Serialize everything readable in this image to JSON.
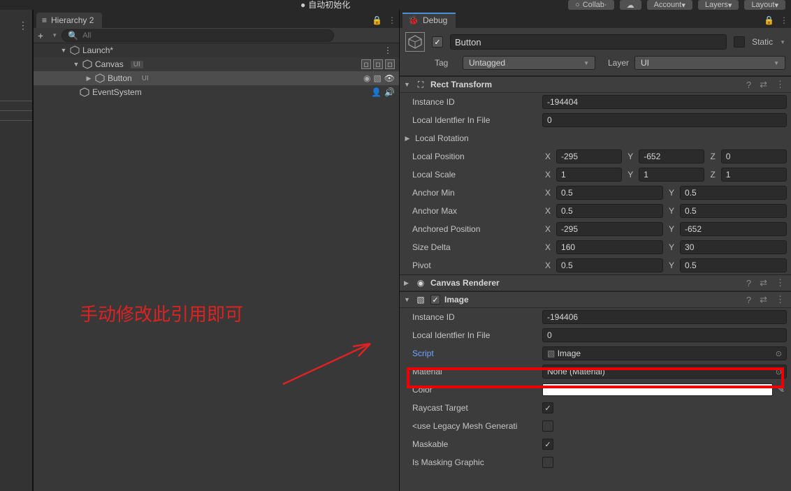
{
  "topbar": {
    "autoinit": "自动初始化",
    "collab": "Collab",
    "account": "Account",
    "layers": "Layers",
    "layout": "Layout"
  },
  "hierarchy": {
    "tab": "Hierarchy 2",
    "search_placeholder": "All",
    "scene": "Launch*",
    "canvas": "Canvas",
    "canvas_tag": "UI",
    "button": "Button",
    "button_tag": "UI",
    "eventsystem": "EventSystem"
  },
  "annotation": "手动修改此引用即可",
  "inspector": {
    "tab": "Debug",
    "name": "Button",
    "static_label": "Static",
    "tag_label": "Tag",
    "tag_value": "Untagged",
    "layer_label": "Layer",
    "layer_value": "UI"
  },
  "rect": {
    "title": "Rect Transform",
    "instance_id_label": "Instance ID",
    "instance_id": "-194404",
    "local_ident_label": "Local Identfier In File",
    "local_ident": "0",
    "local_rotation_label": "Local Rotation",
    "local_position_label": "Local Position",
    "pos_x": "-295",
    "pos_y": "-652",
    "pos_z": "0",
    "local_scale_label": "Local Scale",
    "scale_x": "1",
    "scale_y": "1",
    "scale_z": "1",
    "anchor_min_label": "Anchor Min",
    "amin_x": "0.5",
    "amin_y": "0.5",
    "anchor_max_label": "Anchor Max",
    "amax_x": "0.5",
    "amax_y": "0.5",
    "anchored_pos_label": "Anchored Position",
    "ap_x": "-295",
    "ap_y": "-652",
    "size_delta_label": "Size Delta",
    "sd_x": "160",
    "sd_y": "30",
    "pivot_label": "Pivot",
    "pv_x": "0.5",
    "pv_y": "0.5"
  },
  "canvas_renderer": {
    "title": "Canvas Renderer"
  },
  "image": {
    "title": "Image",
    "instance_id_label": "Instance ID",
    "instance_id": "-194406",
    "local_ident_label": "Local Identfier In File",
    "local_ident": "0",
    "script_label": "Script",
    "script_value": "Image",
    "material_label": "Material",
    "material_value": "None (Material)",
    "color_label": "Color",
    "raycast_label": "Raycast Target",
    "legacy_label": "<use Legacy Mesh Generati",
    "maskable_label": "Maskable",
    "masking_label": "Is Masking Graphic"
  }
}
